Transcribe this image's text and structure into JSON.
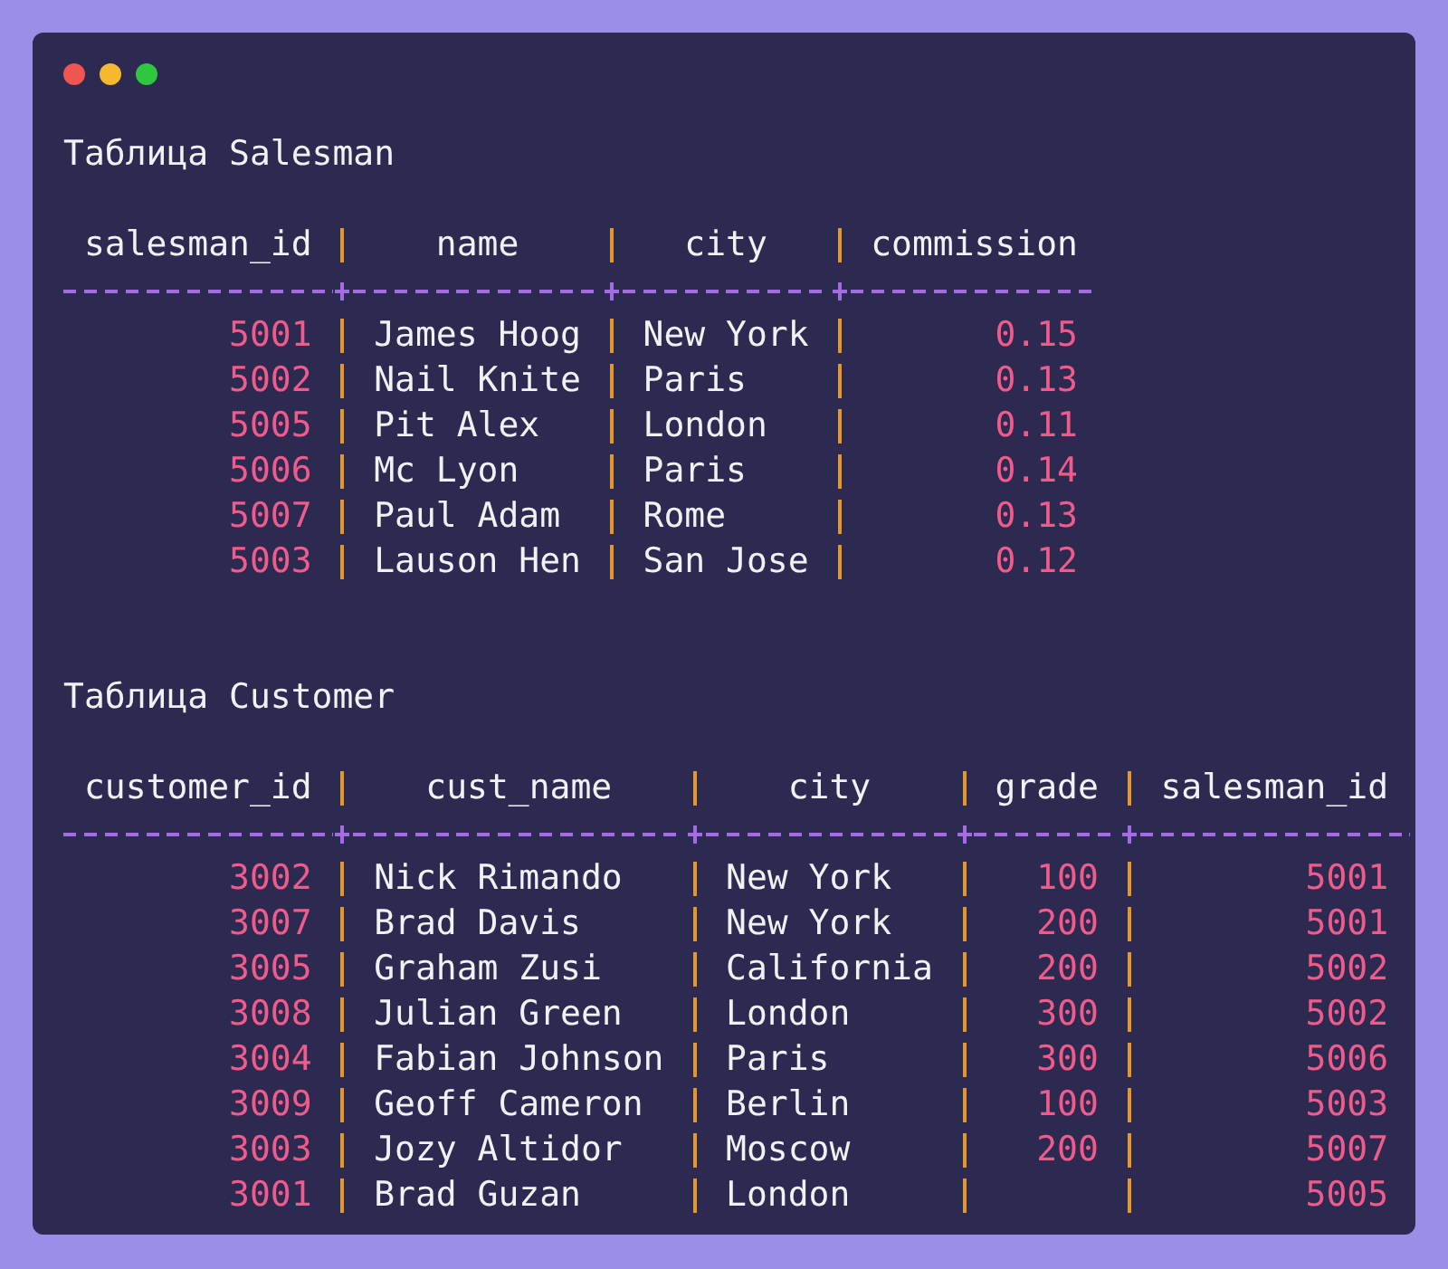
{
  "tables": [
    {
      "title": "Таблица Salesman",
      "columns": [
        {
          "label": "salesman_id",
          "kind": "number"
        },
        {
          "label": "name",
          "kind": "text"
        },
        {
          "label": "city",
          "kind": "text"
        },
        {
          "label": "commission",
          "kind": "number"
        }
      ],
      "rows": [
        [
          "5001",
          "James Hoog",
          "New York",
          "0.15"
        ],
        [
          "5002",
          "Nail Knite",
          "Paris",
          "0.13"
        ],
        [
          "5005",
          "Pit Alex",
          "London",
          "0.11"
        ],
        [
          "5006",
          "Mc Lyon",
          "Paris",
          "0.14"
        ],
        [
          "5007",
          "Paul Adam",
          "Rome",
          "0.13"
        ],
        [
          "5003",
          "Lauson Hen",
          "San Jose",
          "0.12"
        ]
      ]
    },
    {
      "title": "Таблица Customer",
      "columns": [
        {
          "label": "customer_id",
          "kind": "number"
        },
        {
          "label": "cust_name",
          "kind": "text"
        },
        {
          "label": "city",
          "kind": "text"
        },
        {
          "label": "grade",
          "kind": "number"
        },
        {
          "label": "salesman_id",
          "kind": "number"
        }
      ],
      "rows": [
        [
          "3002",
          "Nick Rimando",
          "New York",
          "100",
          "5001"
        ],
        [
          "3007",
          "Brad Davis",
          "New York",
          "200",
          "5001"
        ],
        [
          "3005",
          "Graham Zusi",
          "California",
          "200",
          "5002"
        ],
        [
          "3008",
          "Julian Green",
          "London",
          "300",
          "5002"
        ],
        [
          "3004",
          "Fabian Johnson",
          "Paris",
          "300",
          "5006"
        ],
        [
          "3009",
          "Geoff Cameron",
          "Berlin",
          "100",
          "5003"
        ],
        [
          "3003",
          "Jozy Altidor",
          "Moscow",
          "200",
          "5007"
        ],
        [
          "3001",
          "Brad Guzan",
          "London",
          null,
          "5005"
        ]
      ]
    }
  ]
}
